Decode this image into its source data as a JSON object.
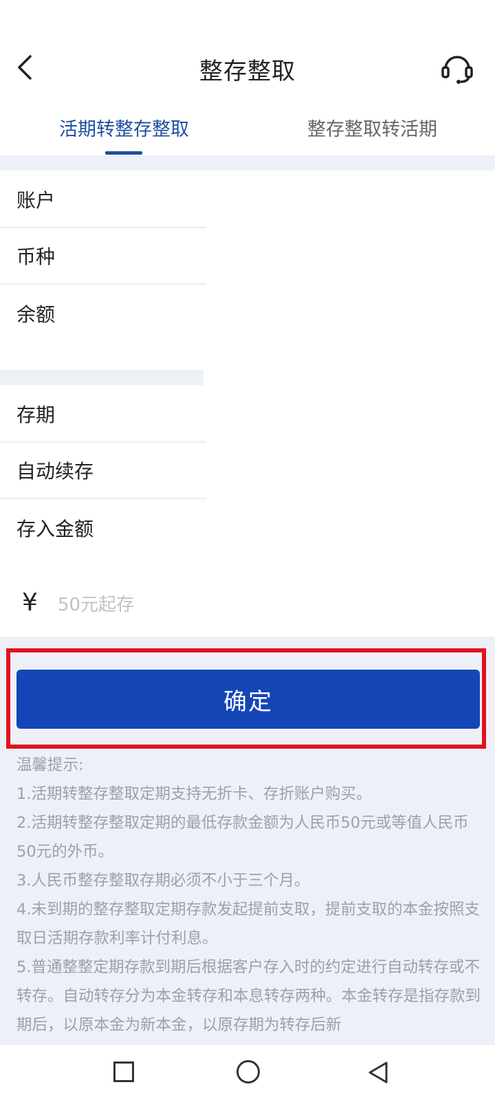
{
  "header": {
    "title": "整存整取"
  },
  "tabs": [
    {
      "label": "活期转整存整取",
      "active": true
    },
    {
      "label": "整存整取转活期",
      "active": false
    }
  ],
  "account_section": [
    {
      "label": "账户"
    },
    {
      "label": "币种"
    },
    {
      "label": "余额"
    }
  ],
  "deposit_section": [
    {
      "label": "存期"
    },
    {
      "label": "自动续存"
    },
    {
      "label": "存入金额"
    }
  ],
  "amount": {
    "currency_symbol": "¥",
    "placeholder": "50元起存",
    "value": ""
  },
  "confirm_button": {
    "label": "确定"
  },
  "tips": {
    "heading": "温馨提示:",
    "items": [
      "1.活期转整存整取定期支持无折卡、存折账户购买。",
      "2.活期转整存整取定期的最低存款金额为人民币50元或等值人民币50元的外币。",
      "3.人民币整存整取存期必须不小于三个月。",
      "4.未到期的整存整取定期存款发起提前支取，提前支取的本金按照支取日活期存款利率计付利息。",
      "5.普通整整定期存款到期后根据客户存入时的约定进行自动转存或不转存。自动转存分为本金转存和本息转存两种。本金转存是指存款到期后，以原本金为新本金，以原存期为转存后新"
    ]
  },
  "colors": {
    "accent": "#1f4f9f",
    "button": "#1446b8",
    "highlight": "#e0121e",
    "section_bg": "#eef0f7"
  },
  "icons": {
    "back": "chevron-left-icon",
    "service": "headset-icon"
  }
}
